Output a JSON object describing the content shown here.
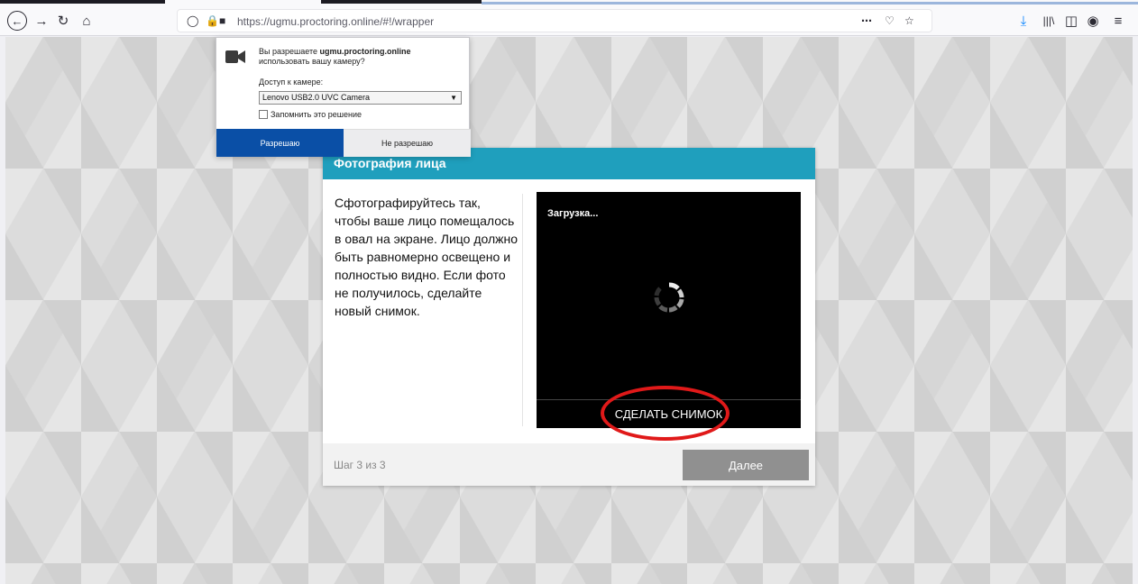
{
  "browser": {
    "url": "https://ugmu.proctoring.online/#!/wrapper",
    "icons": [
      "back-icon",
      "forward-icon",
      "reload-icon",
      "home-icon",
      "shield-icon",
      "lock-icon",
      "camera-icon",
      "more-icon",
      "pocket-icon",
      "star-icon",
      "download-icon",
      "library-icon",
      "sidebar-icon",
      "account-icon",
      "menu-icon"
    ]
  },
  "permission": {
    "question_prefix": "Вы разрешаете ",
    "site": "ugmu.proctoring.online",
    "question_suffix": "использовать вашу камеру?",
    "access_label": "Доступ к камере:",
    "camera_selected": "Lenovo USB2.0 UVC Camera",
    "remember_label": "Запомнить это решение",
    "allow_label": "Разрешаю",
    "deny_label": "Не разрешаю"
  },
  "modal": {
    "title": "Фотография лица",
    "instructions": "Сфотографируйтесь так, чтобы ваше лицо помещалось в овал на экране. Лицо должно быть равномерно освещено и полностью видно. Если фото не получилось, сделайте новый снимок.",
    "loading": "Загрузка...",
    "snapshot_button": "СДЕЛАТЬ СНИМОК",
    "step": "Шаг 3 из 3",
    "next_button": "Далее"
  },
  "colors": {
    "header": "#1f9fbd",
    "allow": "#0a4fa6",
    "highlight": "#e01919",
    "next_disabled": "#909090"
  }
}
